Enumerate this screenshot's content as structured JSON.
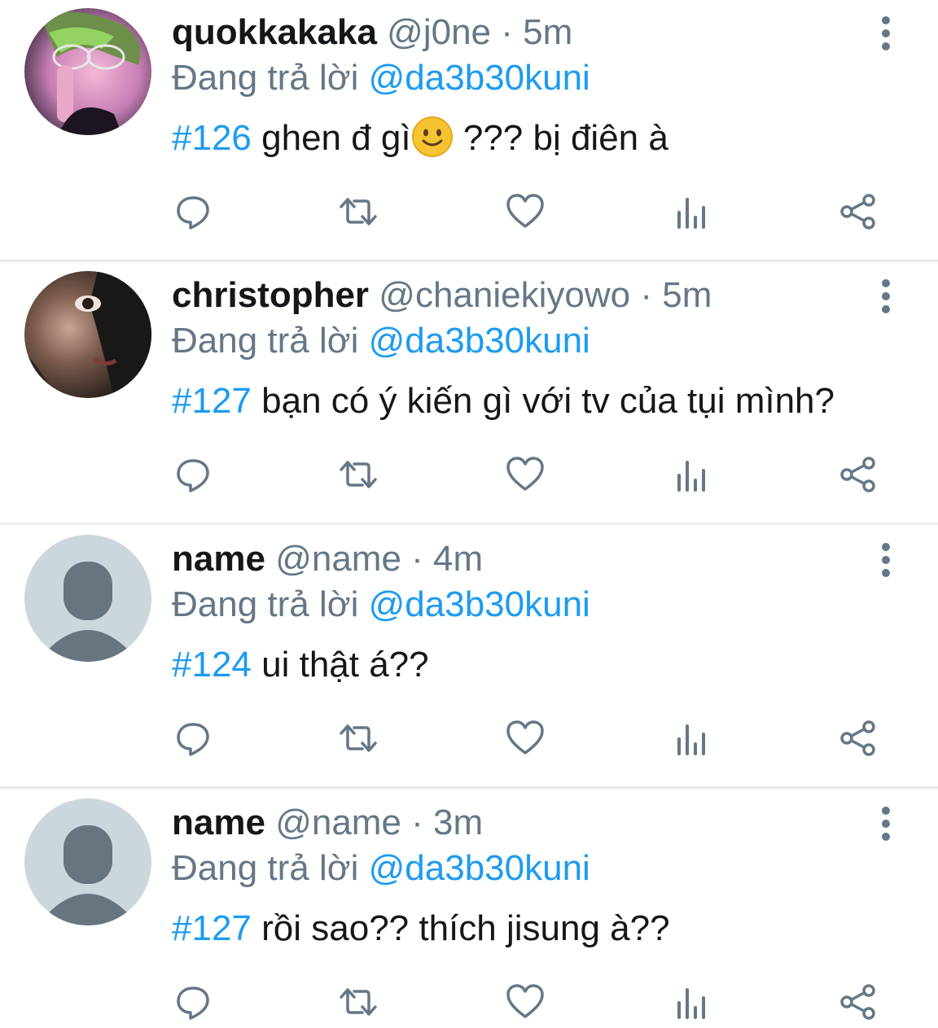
{
  "reply_prefix": "Đang trả lời",
  "separator": "·",
  "colors": {
    "accent": "#1d9bf0",
    "muted": "#657786",
    "text": "#14171a",
    "divider": "#e8ebee"
  },
  "tweets": [
    {
      "display_name": "quokkakaka",
      "handle": "@j0ne",
      "time": "5m",
      "mention": "@da3b30kuni",
      "hashtag": "#126",
      "text_before_emoji": "ghen đ gì",
      "emoji": "slightly-smiling-face",
      "text_after_emoji": " ??? bị điên à",
      "avatar": "photo-avatar"
    },
    {
      "display_name": "christopher",
      "handle": "@chaniekiyowo",
      "time": "5m",
      "mention": "@da3b30kuni",
      "hashtag": "#127",
      "text": "bạn có ý kiến gì với tv của tụi mình?",
      "avatar": "photo-avatar"
    },
    {
      "display_name": "name",
      "handle": "@name",
      "time": "4m",
      "mention": "@da3b30kuni",
      "hashtag": "#124",
      "text": "ui thật á??",
      "avatar": "default-avatar"
    },
    {
      "display_name": "name",
      "handle": "@name",
      "time": "3m",
      "mention": "@da3b30kuni",
      "hashtag": "#127",
      "text": "rồi sao?? thích jisung à??",
      "avatar": "default-avatar"
    }
  ],
  "actions": [
    "reply-icon",
    "retweet-icon",
    "like-icon",
    "views-icon",
    "share-icon"
  ]
}
